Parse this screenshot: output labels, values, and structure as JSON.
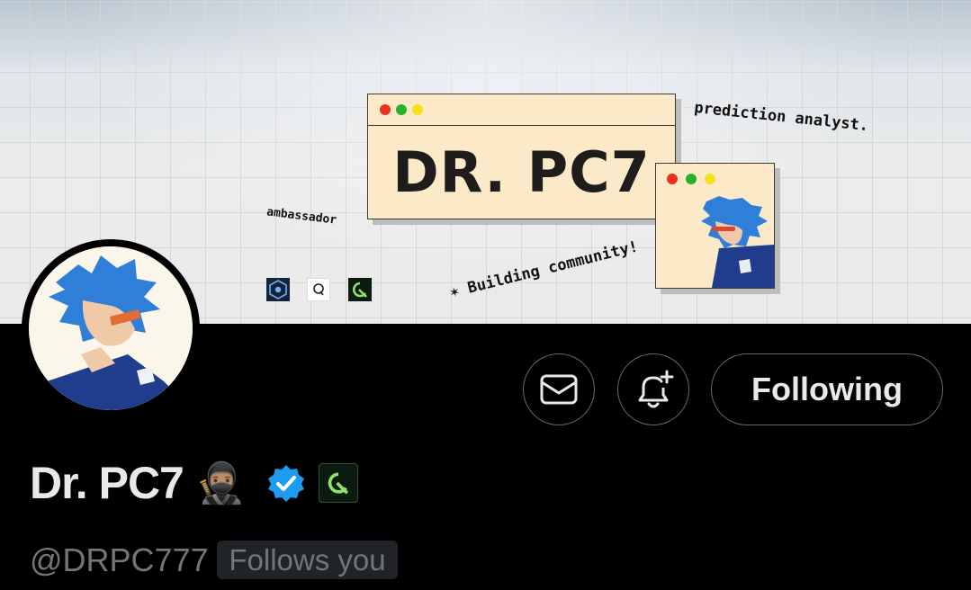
{
  "banner": {
    "window_title": "DR. PC7",
    "tagline_top": "prediction analyst.",
    "tagline_left": "ambassador",
    "tagline_bottom": "Building community!",
    "logos": [
      "hexagon-logo",
      "q-letter-logo",
      "green-q-logo"
    ],
    "window_dot_colors": [
      "#e8321e",
      "#26b32a",
      "#f5e11a"
    ],
    "window_color": "#fbe9c8"
  },
  "profile": {
    "display_name": "Dr. PC7",
    "name_emoji": "🥷🏽",
    "handle": "@DRPC777",
    "follows_you": "Follows you",
    "verified_color": "#1d9bf0",
    "affiliate_badge": "green-q-badge"
  },
  "actions": {
    "message_icon": "envelope-icon",
    "notify_icon": "bell-plus-icon",
    "following_label": "Following"
  },
  "colors": {
    "background": "#000000",
    "text_primary": "#e7e9ea",
    "text_secondary": "#71767b",
    "border": "#5f6a73"
  }
}
